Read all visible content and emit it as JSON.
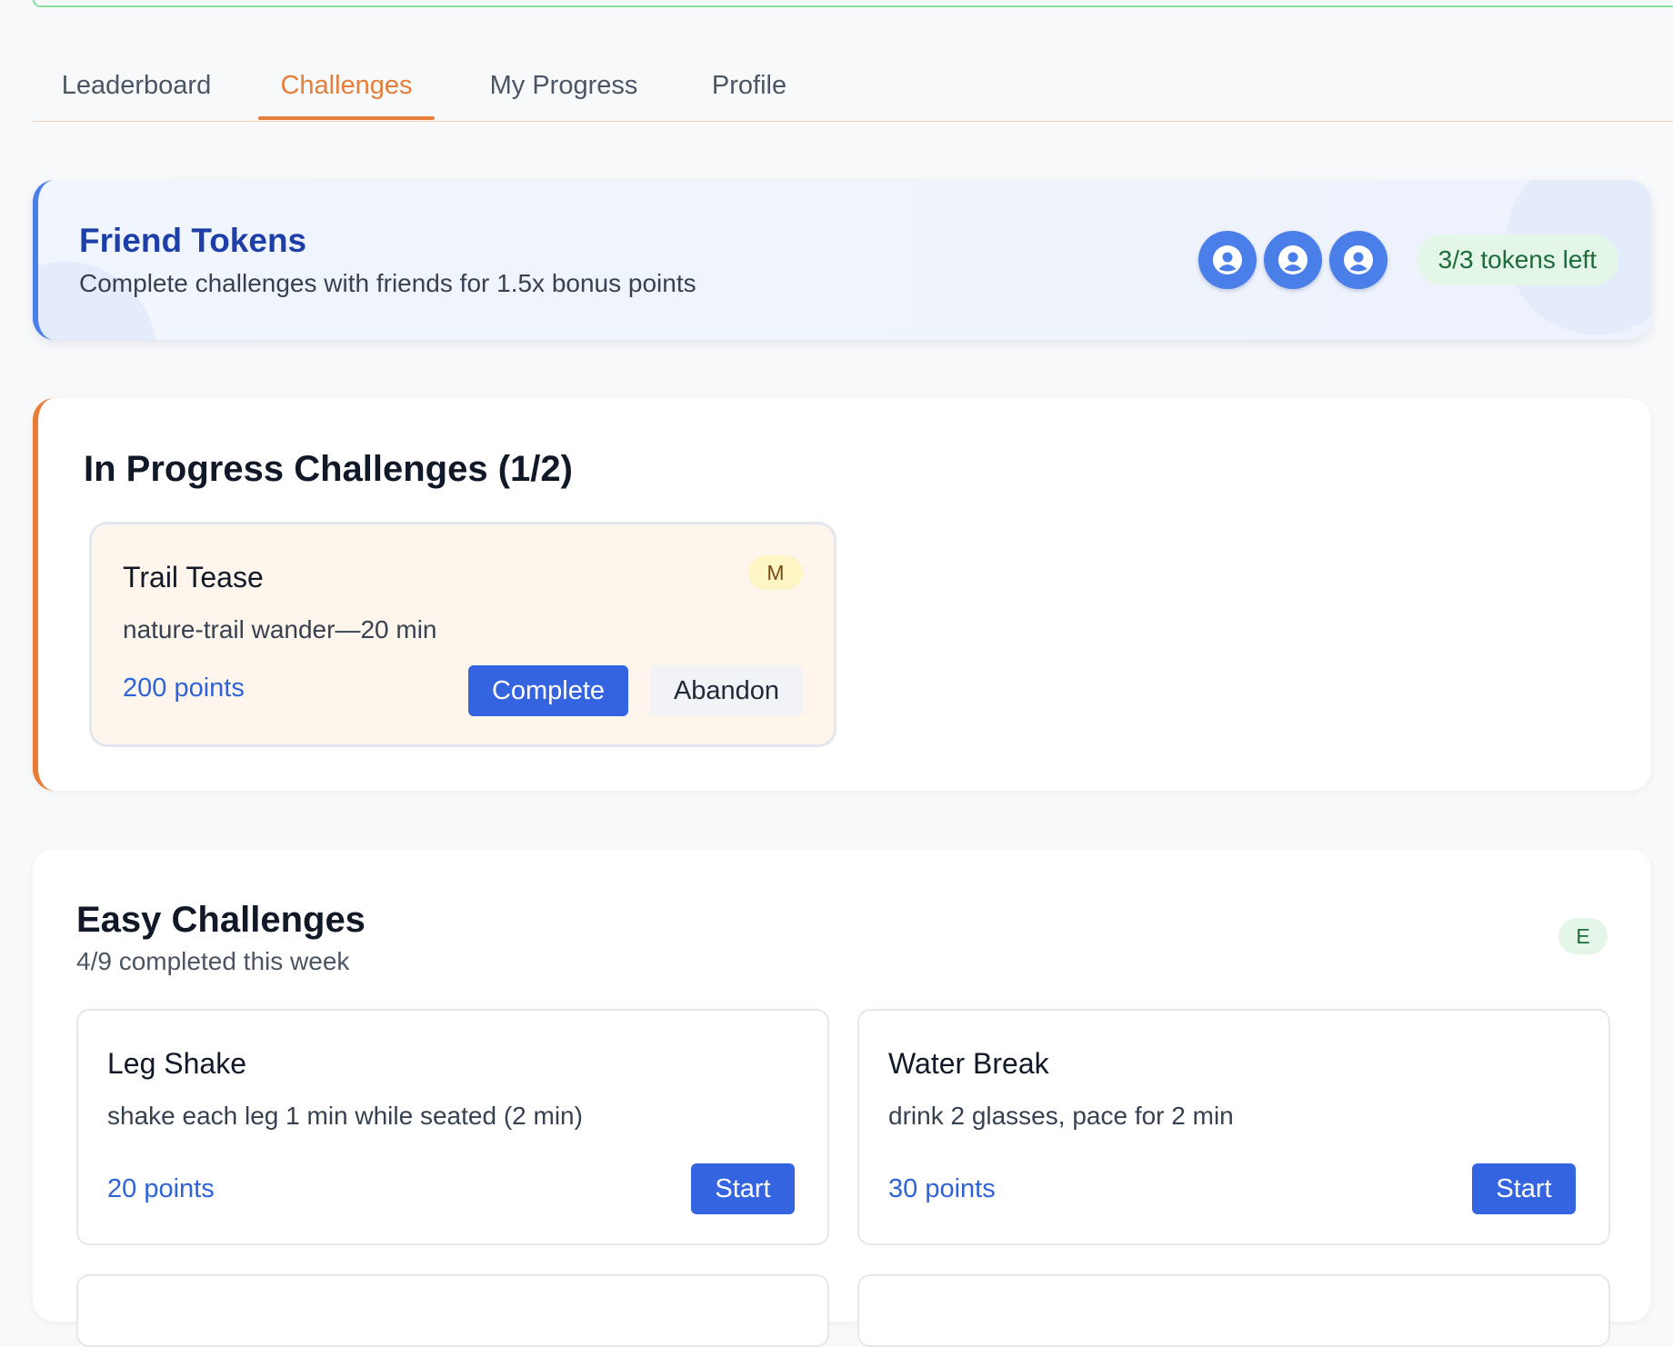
{
  "tabs": [
    {
      "label": "Leaderboard",
      "active": false
    },
    {
      "label": "Challenges",
      "active": true
    },
    {
      "label": "My Progress",
      "active": false
    },
    {
      "label": "Profile",
      "active": false
    }
  ],
  "tokens": {
    "title": "Friend Tokens",
    "subtitle": "Complete challenges with friends for 1.5x bonus points",
    "icons": [
      "user-token-icon",
      "user-token-icon",
      "user-token-icon"
    ],
    "status": "3/3 tokens left"
  },
  "in_progress": {
    "title": "In Progress Challenges (1/2)",
    "card": {
      "title": "Trail Tease",
      "difficulty": "M",
      "description": "nature-trail wander—20 min",
      "points": "200 points",
      "complete_label": "Complete",
      "abandon_label": "Abandon"
    }
  },
  "easy": {
    "title": "Easy Challenges",
    "subtitle": "4/9 completed this week",
    "difficulty": "E",
    "cards": [
      {
        "title": "Leg Shake",
        "description": "shake each leg 1 min while seated (2 min)",
        "points": "20 points",
        "button": "Start"
      },
      {
        "title": "Water Break",
        "description": "drink 2 glasses, pace for 2 min",
        "points": "30 points",
        "button": "Start"
      }
    ]
  },
  "colors": {
    "accent": "#e67e3a",
    "primary": "#3464e0",
    "token_blue": "#4a7ee8",
    "success_bg": "#e3f6e8"
  }
}
